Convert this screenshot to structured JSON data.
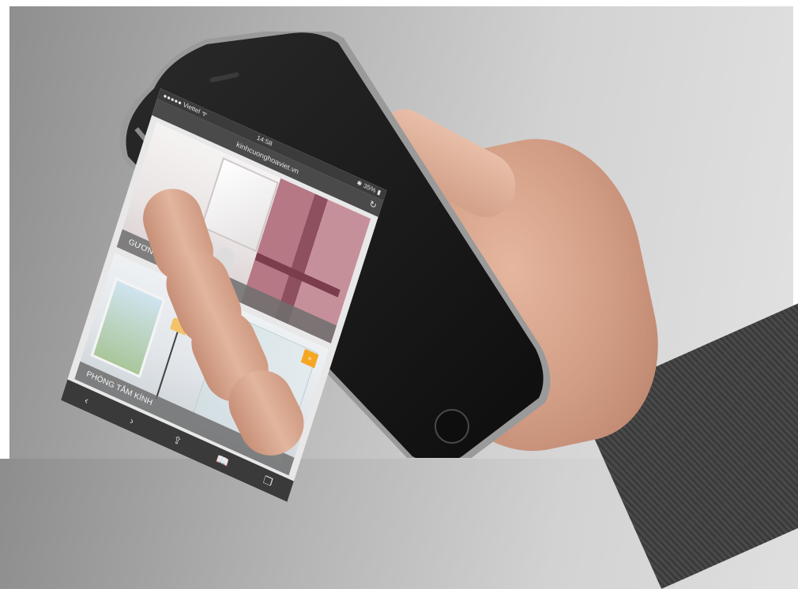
{
  "scene": {
    "description_colors": {
      "background": "#c8c8c8",
      "phone_body": "#161616",
      "skin": "#dba890",
      "sleeve": "#3f3f3f"
    }
  },
  "phone": {
    "status_bar": {
      "carrier": "●●●●● Viettel ᯤ",
      "time": "14:58",
      "battery": "✱ 35% ▮"
    },
    "url_bar": {
      "url": "kinhcuonghoaviet.vn",
      "reload_icon": "↻"
    },
    "cards": [
      {
        "label": "GƯƠNG"
      },
      {
        "label": "PHÒNG TẮM KÍNH",
        "tag": "»"
      }
    ],
    "toolbar": {
      "back": "‹",
      "forward": "›",
      "share": "⇪",
      "bookmarks": "📖",
      "tabs": "❐"
    }
  }
}
